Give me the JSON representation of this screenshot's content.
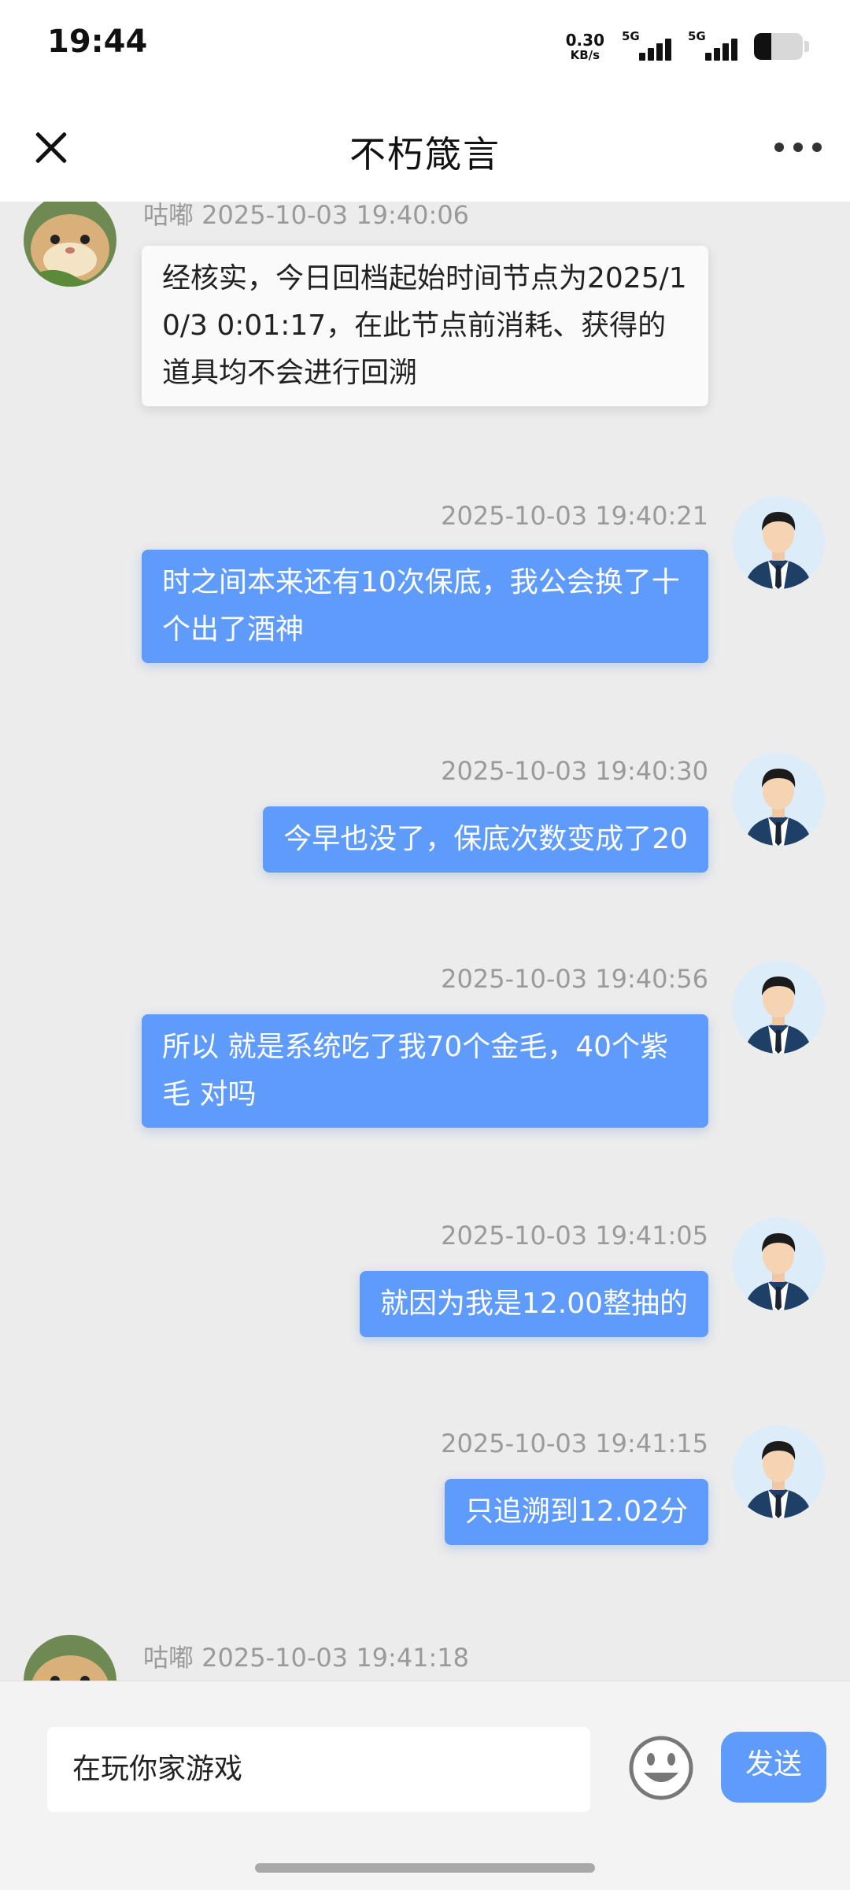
{
  "status_bar": {
    "time": "19:44",
    "net_speed": "0.30",
    "net_unit": "KB/s",
    "signal_1": "5G",
    "signal_2": "5G",
    "battery_icon": "battery-icon"
  },
  "header": {
    "title": "不朽箴言",
    "close_icon": "close-icon",
    "more_icon": "more-icon"
  },
  "messages": [
    {
      "side": "in",
      "meta": "咕嘟 2025-10-03 19:40:06",
      "text": "经核实，今日回档起始时间节点为2025/10/3 0:01:17，在此节点前消耗、获得的道具均不会进行回溯"
    },
    {
      "side": "out",
      "meta": "2025-10-03 19:40:21",
      "text": "时之间本来还有10次保底，我公会换了十个出了酒神"
    },
    {
      "side": "out",
      "meta": "2025-10-03 19:40:30",
      "text": "今早也没了，保底次数变成了20"
    },
    {
      "side": "out",
      "meta": "2025-10-03 19:40:56",
      "text": "所以 就是系统吃了我70个金毛，40个紫毛 对吗"
    },
    {
      "side": "out",
      "meta": "2025-10-03 19:41:05",
      "text": "就因为我是12.00整抽的"
    },
    {
      "side": "out",
      "meta": "2025-10-03 19:41:15",
      "text": "只追溯到12.02分"
    },
    {
      "side": "in",
      "meta": "咕嘟 2025-10-03 19:41:18",
      "text": ""
    }
  ],
  "input": {
    "value": "在玩你家游戏",
    "emoji_icon": "smiley-icon",
    "send_label": "发送"
  },
  "colors": {
    "outgoing_bubble": "#5f9bfb",
    "incoming_bubble": "#fafafa",
    "chat_background": "#ececec",
    "send_button": "#5f9bfb"
  }
}
